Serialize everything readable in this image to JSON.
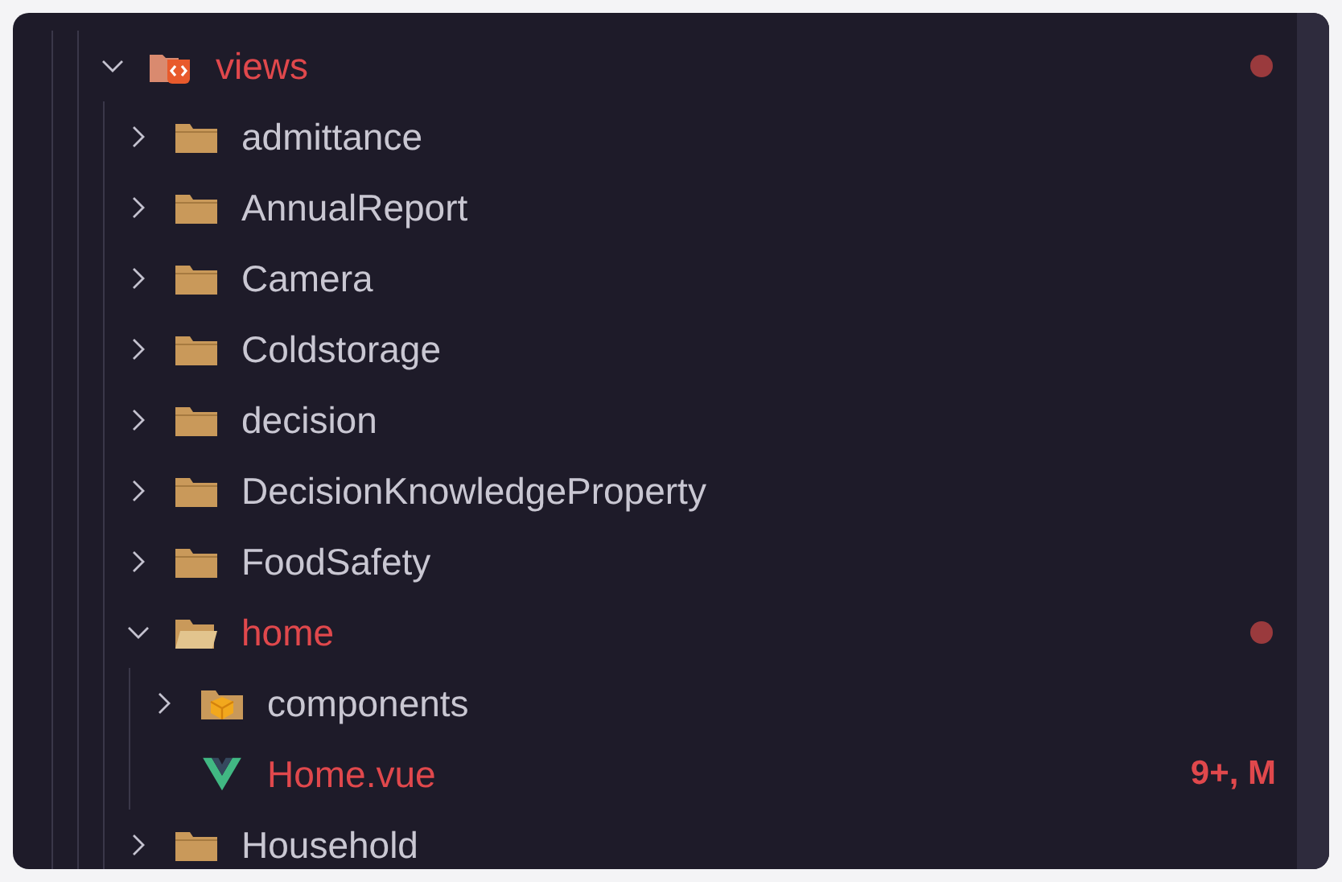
{
  "tree": [
    {
      "name": "views",
      "kind": "views-folder",
      "expanded": true,
      "modified": true,
      "children": [
        {
          "name": "admittance",
          "kind": "folder",
          "expanded": false,
          "modified": false
        },
        {
          "name": "AnnualReport",
          "kind": "folder",
          "expanded": false,
          "modified": false
        },
        {
          "name": "Camera",
          "kind": "folder",
          "expanded": false,
          "modified": false
        },
        {
          "name": "Coldstorage",
          "kind": "folder",
          "expanded": false,
          "modified": false
        },
        {
          "name": "decision",
          "kind": "folder",
          "expanded": false,
          "modified": false
        },
        {
          "name": "DecisionKnowledgeProperty",
          "kind": "folder",
          "expanded": false,
          "modified": false
        },
        {
          "name": "FoodSafety",
          "kind": "folder",
          "expanded": false,
          "modified": false
        },
        {
          "name": "home",
          "kind": "folder",
          "expanded": true,
          "modified": true,
          "children": [
            {
              "name": "components",
              "kind": "components-folder",
              "expanded": false,
              "modified": false
            },
            {
              "name": "Home.vue",
              "kind": "vue-file",
              "modified": true,
              "badge": "9+, M"
            }
          ]
        },
        {
          "name": "Household",
          "kind": "folder",
          "expanded": false,
          "modified": false
        }
      ]
    }
  ]
}
